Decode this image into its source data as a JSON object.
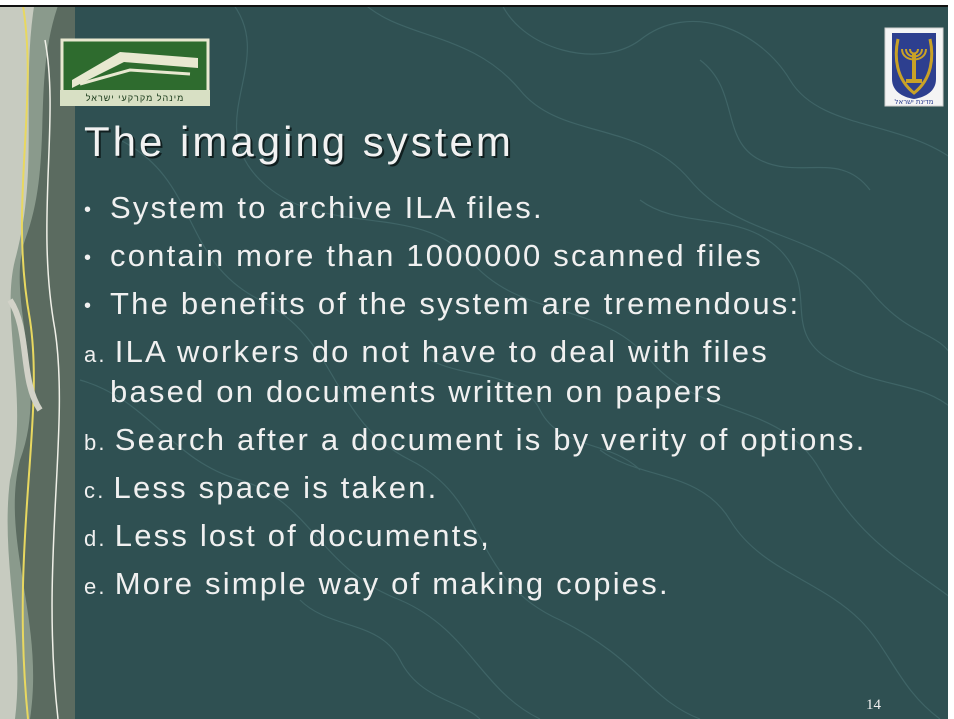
{
  "slide": {
    "title": "The imaging system",
    "bullets": [
      {
        "marker": "•",
        "text": "System to archive ILA files."
      },
      {
        "marker": "•",
        "text": "contain more than 1000000 scanned files"
      },
      {
        "marker": "•",
        "text": "The benefits of the system are tremendous:"
      }
    ],
    "items": [
      {
        "marker": "a.",
        "text": "ILA workers do not have to deal with files",
        "continuation": "based on documents written on papers"
      },
      {
        "marker": "b.",
        "text": "Search after a document is by verity of options."
      },
      {
        "marker": "c.",
        "text": "Less space is taken."
      },
      {
        "marker": "d.",
        "text": "Less lost of documents,"
      },
      {
        "marker": "e.",
        "text": "More simple way of making copies."
      }
    ],
    "page_number": "14"
  },
  "logos": {
    "ila_caption": "מינהל מקרקעי ישראל",
    "emblem_caption": "מדינת ישראל"
  },
  "colors": {
    "background": "#2f5052",
    "text": "#f0f0f0",
    "logo_green": "#2e6b2e"
  }
}
